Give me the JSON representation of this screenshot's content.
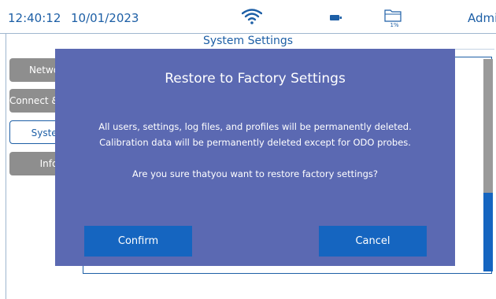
{
  "status_bar": {
    "time": "12:40:12",
    "date": "10/01/2023",
    "storage_percent": "1%",
    "user": "Admin",
    "icons": [
      "wifi-icon",
      "battery-icon",
      "storage-folder-icon"
    ]
  },
  "page": {
    "title": "System Settings"
  },
  "sidebar": {
    "items": [
      {
        "label": "Network"
      },
      {
        "label": "Connect & Share"
      },
      {
        "label": "System"
      },
      {
        "label": "Info"
      }
    ]
  },
  "dialog": {
    "title": "Restore to Factory Settings",
    "line1": "All users, settings, log files, and profiles will be permanently deleted.",
    "line2": "Calibration data will be permanently deleted except for ODO probes.",
    "question": "Are you sure thatyou want to restore factory settings?",
    "confirm_label": "Confirm",
    "cancel_label": "Cancel"
  },
  "colors": {
    "accent": "#1d5fa6",
    "dialog_bg": "#5b69b2",
    "button_bg": "#1565c0",
    "tab_grey": "#8e8e8e"
  }
}
